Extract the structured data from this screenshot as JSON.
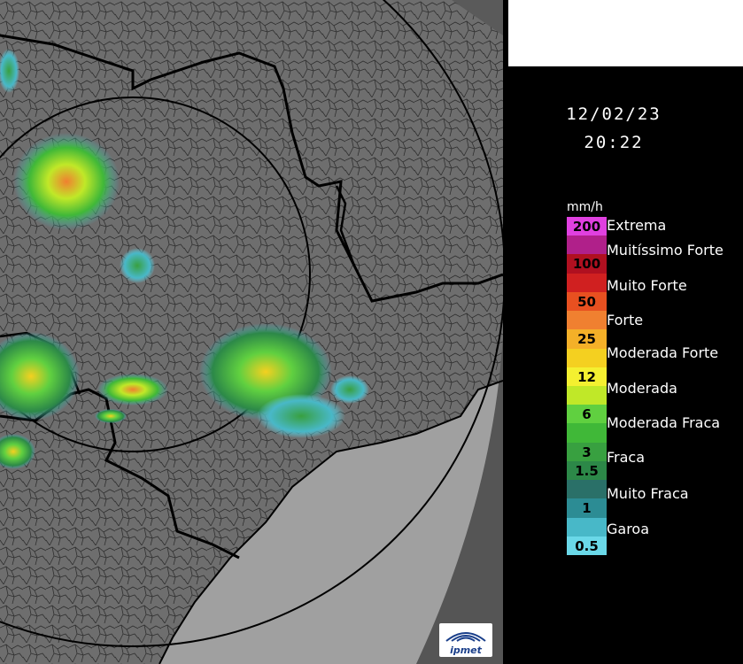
{
  "datetime": {
    "date": "12/02/23",
    "time": "20:22"
  },
  "legend": {
    "unit": "mm/h",
    "scale": [
      {
        "value": "200",
        "color": "#e040e0"
      },
      {
        "value": "",
        "color": "#b0208a"
      },
      {
        "value": "100",
        "color": "#b01020"
      },
      {
        "value": "",
        "color": "#d02020"
      },
      {
        "value": "50",
        "color": "#e85020"
      },
      {
        "value": "",
        "color": "#f08030"
      },
      {
        "value": "25",
        "color": "#f4b028"
      },
      {
        "value": "",
        "color": "#f4d020"
      },
      {
        "value": "12",
        "color": "#f4f030"
      },
      {
        "value": "",
        "color": "#c0e828"
      },
      {
        "value": "6",
        "color": "#60d040"
      },
      {
        "value": "",
        "color": "#40b838"
      },
      {
        "value": "3",
        "color": "#38a040"
      },
      {
        "value": "1.5",
        "color": "#2c8848"
      },
      {
        "value": "",
        "color": "#2a7068"
      },
      {
        "value": "1",
        "color": "#2c8c94"
      },
      {
        "value": "",
        "color": "#48b8c8"
      },
      {
        "value": "0.5",
        "color": "#6ad8e8"
      }
    ],
    "categories": [
      "Extrema",
      "Muitíssimo Forte",
      "Muito Forte",
      "Forte",
      "Moderada Forte",
      "Moderada",
      "Moderada Fraca",
      "Fraca",
      "Muito Fraca",
      "Garoa"
    ]
  },
  "logo": {
    "text": "ipmet"
  },
  "colors": {
    "map_background": "#6e6e6e",
    "borders": "#000000",
    "sea": "#a0a0a0"
  }
}
